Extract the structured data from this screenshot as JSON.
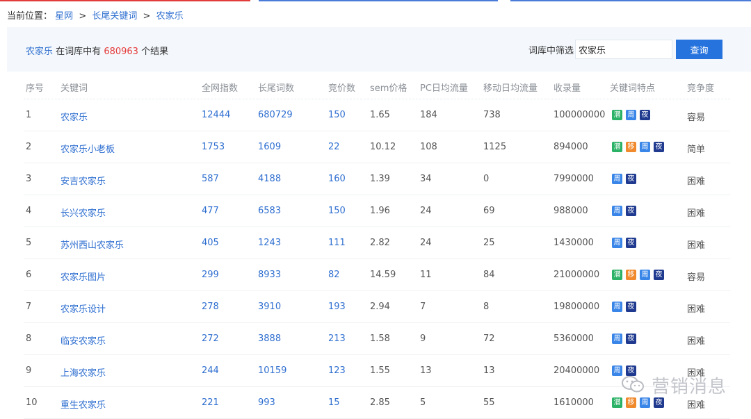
{
  "breadcrumb": {
    "prefix": "当前位置：",
    "items": [
      "星网",
      "长尾关键词",
      "农家乐"
    ],
    "separator": ">"
  },
  "summary": {
    "keyword": "农家乐",
    "middle_text": "在词库中有",
    "count": "680963",
    "suffix": "个结果"
  },
  "filter": {
    "label": "词库中筛选",
    "value": "农家乐",
    "button": "查询"
  },
  "table": {
    "headers": [
      "序号",
      "关键词",
      "全网指数",
      "长尾词数",
      "竞价数",
      "sem价格",
      "PC日均流量",
      "移动日均流量",
      "收录量",
      "关键词特点",
      "竞争度"
    ],
    "rows": [
      {
        "no": "1",
        "keyword": "农家乐",
        "index": "12444",
        "longtail": "680729",
        "bids": "150",
        "sem": "1.65",
        "pc": "184",
        "mobile": "738",
        "indexed": "100000000",
        "tags": [
          "潜",
          "周",
          "夜"
        ],
        "competition": "容易"
      },
      {
        "no": "2",
        "keyword": "农家乐小老板",
        "index": "1753",
        "longtail": "1609",
        "bids": "22",
        "sem": "10.12",
        "pc": "108",
        "mobile": "1125",
        "indexed": "894000",
        "tags": [
          "潜",
          "移",
          "周",
          "夜"
        ],
        "competition": "简单"
      },
      {
        "no": "3",
        "keyword": "安吉农家乐",
        "index": "587",
        "longtail": "4188",
        "bids": "160",
        "sem": "1.39",
        "pc": "34",
        "mobile": "0",
        "indexed": "7990000",
        "tags": [
          "周",
          "夜"
        ],
        "competition": "困难"
      },
      {
        "no": "4",
        "keyword": "长兴农家乐",
        "index": "477",
        "longtail": "6583",
        "bids": "150",
        "sem": "1.96",
        "pc": "24",
        "mobile": "69",
        "indexed": "988000",
        "tags": [
          "周",
          "夜"
        ],
        "competition": "困难"
      },
      {
        "no": "5",
        "keyword": "苏州西山农家乐",
        "index": "405",
        "longtail": "1243",
        "bids": "111",
        "sem": "2.82",
        "pc": "24",
        "mobile": "25",
        "indexed": "1430000",
        "tags": [
          "周",
          "夜"
        ],
        "competition": "困难"
      },
      {
        "no": "6",
        "keyword": "农家乐图片",
        "index": "299",
        "longtail": "8933",
        "bids": "82",
        "sem": "14.59",
        "pc": "11",
        "mobile": "84",
        "indexed": "21000000",
        "tags": [
          "潜",
          "移",
          "周",
          "夜"
        ],
        "competition": "容易"
      },
      {
        "no": "7",
        "keyword": "农家乐设计",
        "index": "278",
        "longtail": "3910",
        "bids": "193",
        "sem": "2.94",
        "pc": "7",
        "mobile": "8",
        "indexed": "19800000",
        "tags": [
          "周",
          "夜"
        ],
        "competition": "困难"
      },
      {
        "no": "8",
        "keyword": "临安农家乐",
        "index": "272",
        "longtail": "3888",
        "bids": "213",
        "sem": "1.58",
        "pc": "9",
        "mobile": "72",
        "indexed": "5360000",
        "tags": [
          "周",
          "夜"
        ],
        "competition": "困难"
      },
      {
        "no": "9",
        "keyword": "上海农家乐",
        "index": "244",
        "longtail": "10159",
        "bids": "123",
        "sem": "1.55",
        "pc": "13",
        "mobile": "13",
        "indexed": "20400000",
        "tags": [
          "周",
          "夜"
        ],
        "competition": "困难"
      },
      {
        "no": "10",
        "keyword": "重生农家乐",
        "index": "221",
        "longtail": "993",
        "bids": "15",
        "sem": "2.85",
        "pc": "5",
        "mobile": "55",
        "indexed": "1610000",
        "tags": [
          "潜",
          "移",
          "周",
          "夜"
        ],
        "competition": "困难"
      }
    ]
  },
  "tag_colors": {
    "潜": "#2bb267",
    "移": "#f08a2d",
    "周": "#3a86e8",
    "夜": "#1f3a8f"
  },
  "watermark": {
    "text": "营销消息",
    "icon": "wechat-icon"
  }
}
